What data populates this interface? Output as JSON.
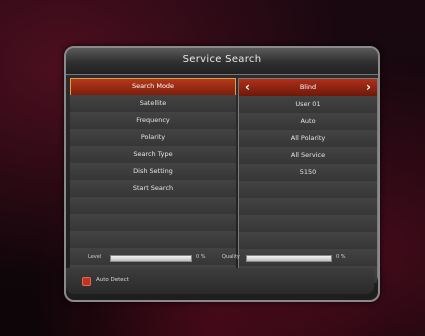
{
  "screen": {
    "title": "Service Search"
  },
  "menu": {
    "labels": [
      "Search Mode",
      "Satellite",
      "Frequency",
      "Polarity",
      "Search Type",
      "Dish Setting",
      "Start Search"
    ],
    "values": [
      "Blind",
      "User 01",
      "Auto",
      "All Polarity",
      "All Service",
      "5150"
    ],
    "selected_index": 0
  },
  "meters": {
    "level_label": "Level",
    "level_value": "0 %",
    "quality_label": "Quality",
    "quality_value": "0 %"
  },
  "hint": {
    "text": "Auto Detect",
    "button_color": "#c03222"
  },
  "icons": {
    "left_arrow": "chevron-left-icon",
    "right_arrow": "chevron-right-icon",
    "red_button": "red-button-icon"
  }
}
